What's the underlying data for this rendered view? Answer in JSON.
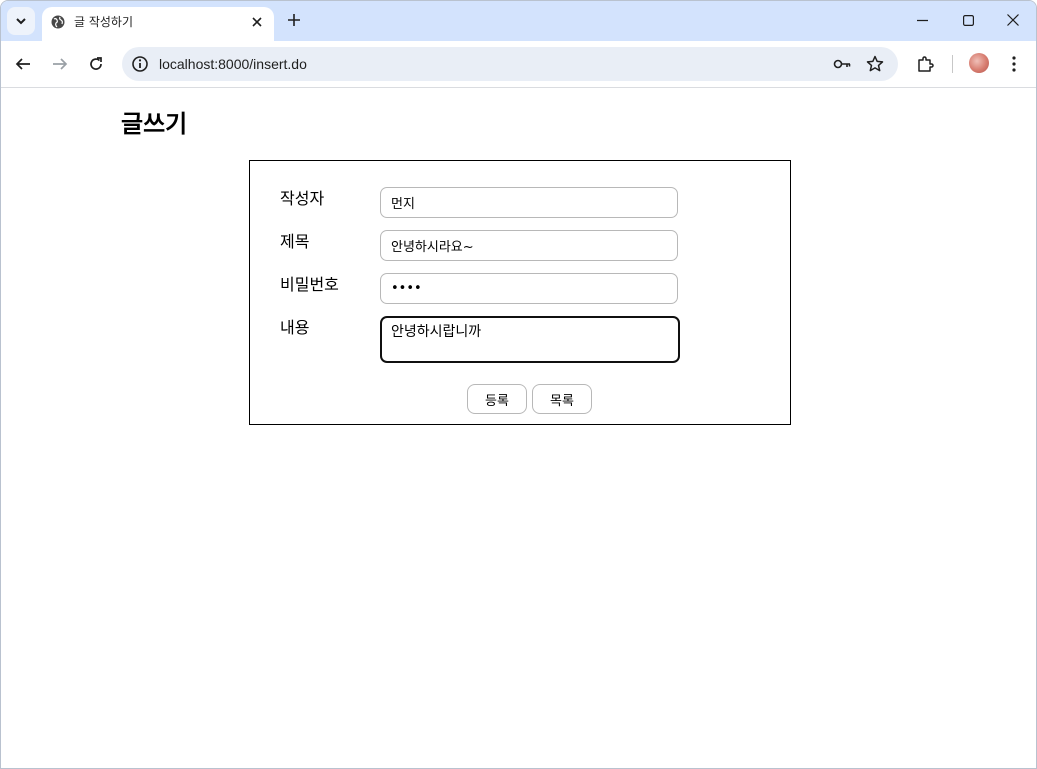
{
  "browser": {
    "tab_title": "글 작성하기",
    "url": "localhost:8000/insert.do",
    "icons": [
      "tab-search-icon",
      "globe-icon",
      "close-icon",
      "plus-icon",
      "minimize-icon",
      "maximize-icon",
      "window-close-icon",
      "back-arrow-icon",
      "forward-arrow-icon",
      "reload-icon",
      "info-icon",
      "key-icon",
      "star-icon",
      "extensions-icon",
      "avatar",
      "more-vertical-icon"
    ]
  },
  "page": {
    "title": "글쓰기"
  },
  "form": {
    "author_label": "작성자",
    "author_value": "먼지",
    "subject_label": "제목",
    "subject_value": "안녕하시라요~",
    "password_label": "비밀번호",
    "password_value": "1234",
    "content_label": "내용",
    "content_value": "안녕하시랍니까",
    "submit_label": "등록",
    "list_label": "목록"
  },
  "colors": {
    "tabstrip": "#d3e3fd",
    "omnibox": "#e9eef6",
    "border": "#000000"
  }
}
